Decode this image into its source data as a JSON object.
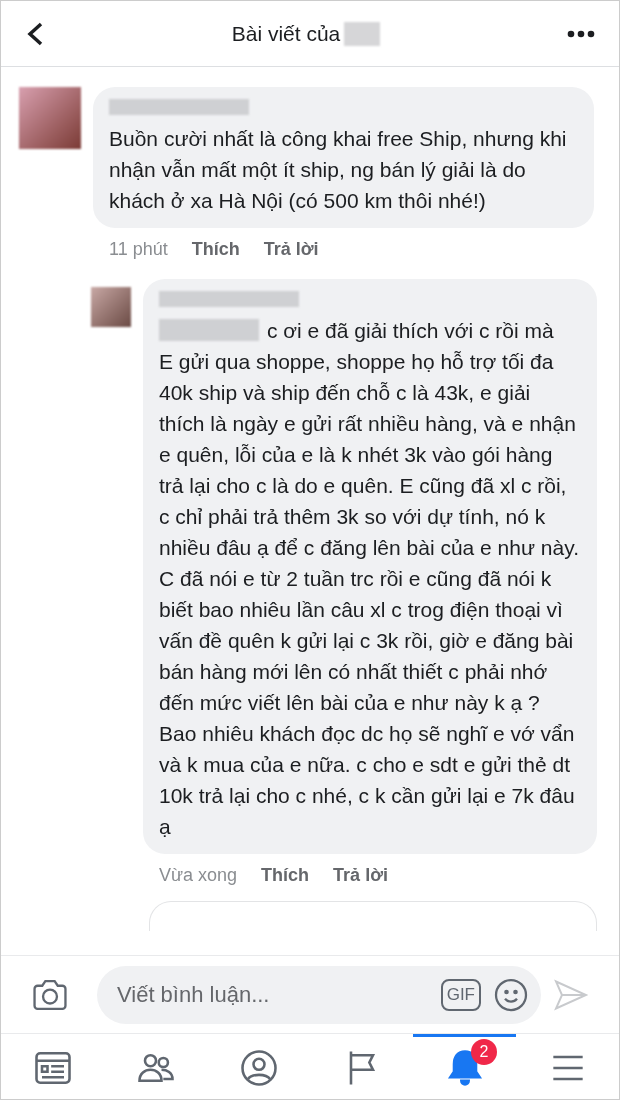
{
  "header": {
    "title": "Bài viết của"
  },
  "comments": [
    {
      "text": "Buồn cười nhất là công khai free Ship, nhưng khi nhận vẫn mất một ít ship, ng bán lý giải là do khách ở xa Hà Nội (có 500 km thôi nhé!)",
      "time": "11 phút",
      "like": "Thích",
      "reply": "Trả lời",
      "reply_level": false
    },
    {
      "lead": "c ơi e đã giải thích với c rồi mà",
      "text": "E gửi qua shoppe, shoppe họ hỗ trợ tối đa 40k ship và ship đến chỗ c là 43k, e giải thích là ngày e gửi rất nhiều hàng, và e nhận e quên, lỗi của e là k nhét 3k vào gói hàng trả lại cho c là do e quên. E cũng đã xl c rồi, c chỉ phải trả thêm 3k so với dự tính, nó k nhiều đâu ạ để c đăng lên bài của e như này. C đã nói e từ 2 tuần trc rồi e cũng đã nói k biết bao nhiêu lần câu xl c trog điện thoại vì vấn đề quên k gửi lại c 3k rồi, giờ e đăng bài bán hàng mới lên có nhất thiết c phải nhớ đến mức viết lên bài của e như này k ạ ? Bao nhiêu khách đọc dc họ sẽ nghĩ e vớ vẩn và k mua của e nữa. c cho e sdt e gửi thẻ dt 10k trả lại cho c nhé, c k cần gửi lại e 7k đâu ạ",
      "time": "Vừa xong",
      "like": "Thích",
      "reply": "Trả lời",
      "reply_level": true
    }
  ],
  "composer": {
    "placeholder": "Viết bình luận...",
    "gif": "GIF"
  },
  "nav": [
    {
      "kind": "feed",
      "selected": false
    },
    {
      "kind": "friends",
      "selected": false
    },
    {
      "kind": "profile",
      "selected": false
    },
    {
      "kind": "pages",
      "selected": false
    },
    {
      "kind": "notifications",
      "selected": true,
      "badge": "2"
    },
    {
      "kind": "menu",
      "selected": false
    }
  ]
}
